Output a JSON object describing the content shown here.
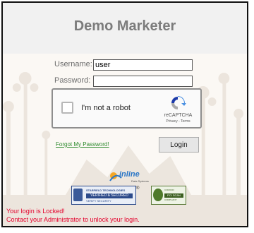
{
  "header": {
    "title": "Demo Marketer"
  },
  "form": {
    "username_label": "Username:",
    "username_value": "user",
    "password_label": "Password:",
    "password_value": "",
    "forgot_link": "Forgot My Password!",
    "login_button": "Login"
  },
  "recaptcha": {
    "checkbox_label": "I'm not a robot",
    "brand": "reCAPTCHA",
    "links": "Privacy - Terms"
  },
  "logos": {
    "inline_name": "inline",
    "inline_sub": "Data Systems",
    "starfield_line1": "STARFIELD TECHNOLOGIES",
    "starfield_line2": "VERIFIED & SECURED",
    "starfield_line3": "VERIFY SECURITY",
    "comodo_line1": "COMODO",
    "comodo_line2": "PCI SCAN",
    "comodo_line3": "COMPLIANT"
  },
  "errors": {
    "line1": "Your login is Locked!",
    "line2": "Contact your Administrator to unlock your login."
  },
  "colors": {
    "title": "#7c7c7c",
    "link": "#2d8a2d",
    "error": "#e4002b"
  }
}
